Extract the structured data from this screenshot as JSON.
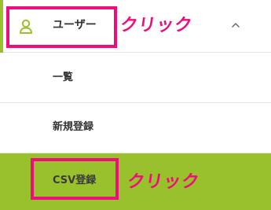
{
  "menu": {
    "parent": {
      "label": "ユーザー",
      "icon": "user-icon",
      "expanded_icon": "chevron-up-icon"
    },
    "items": [
      {
        "label": "一覧"
      },
      {
        "label": "新規登録"
      },
      {
        "label": "CSV登録",
        "active": true
      }
    ]
  },
  "annotations": {
    "click_label_1": "クリック",
    "click_label_2": "クリック",
    "highlight_color": "#ef0c7c"
  },
  "colors": {
    "accent": "#99c12b",
    "text": "#333333"
  }
}
